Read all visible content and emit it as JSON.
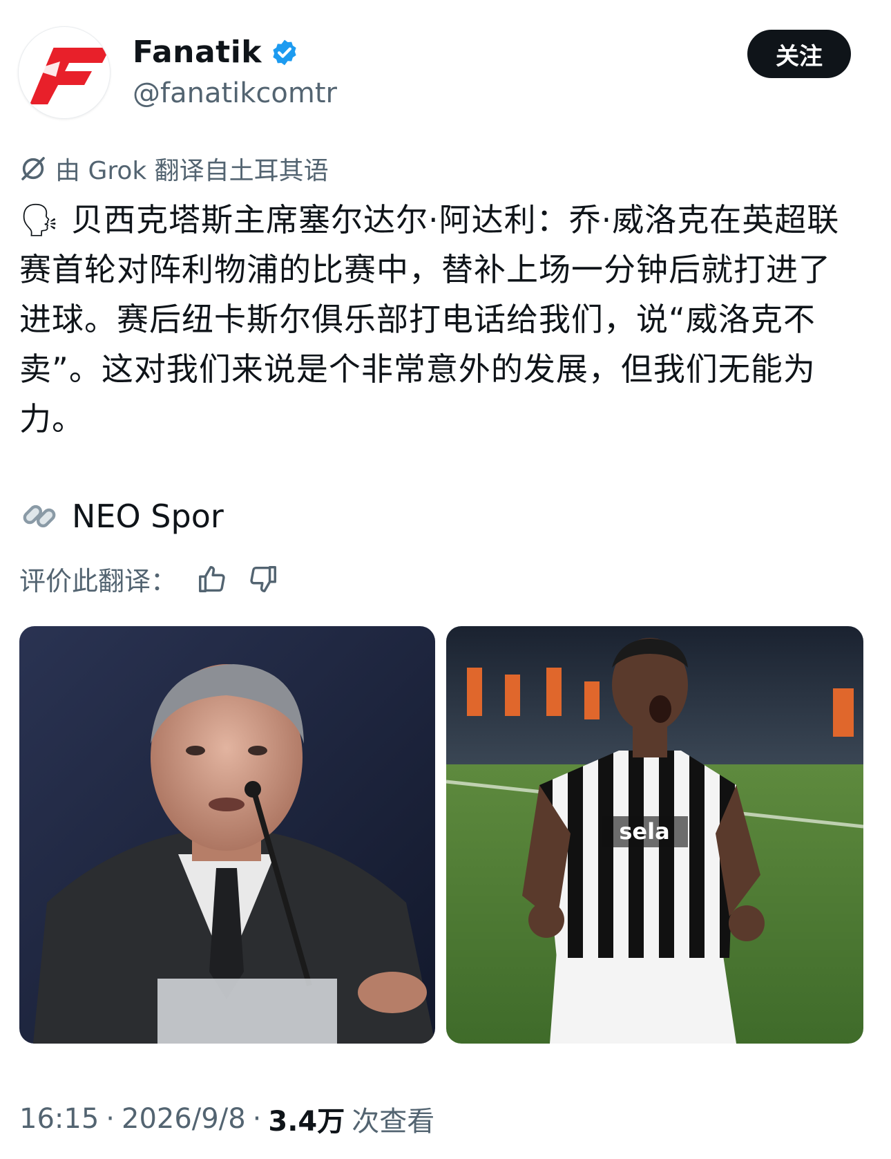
{
  "header": {
    "display_name": "Fanatik",
    "handle": "@fanatikcomtr",
    "verified": true,
    "follow_label": "关注",
    "avatar_icon": "fanatik-f-logo",
    "accent_color": "#e8202a",
    "verified_color": "#1d9bf0"
  },
  "translation": {
    "note": "由 Grok 翻译自土耳其语",
    "icon": "grok-icon"
  },
  "tweet": {
    "emoji": "🗣",
    "text": "贝西克塔斯主席塞尔达尔·阿达利：乔·威洛克在英超联赛首轮对阵利物浦的比赛中，替补上场一分钟后就打进了进球。赛后纽卡斯尔俱乐部打电话给我们，说“威洛克不卖”。这对我们来说是个非常意外的发展，但我们无能为力。",
    "source_label": "NEO Spor",
    "source_icon": "link-icon"
  },
  "rating": {
    "label": "评价此翻译：",
    "up_icon": "thumbs-up-icon",
    "down_icon": "thumbs-down-icon"
  },
  "media": {
    "left_kind": "photo-man-at-press-conference",
    "right_kind": "photo-footballer-celebrating-striped-kit"
  },
  "footer": {
    "time": "16:15",
    "date": "2026/9/8",
    "views": "3.4万",
    "views_label": "次查看",
    "separator": "·"
  }
}
